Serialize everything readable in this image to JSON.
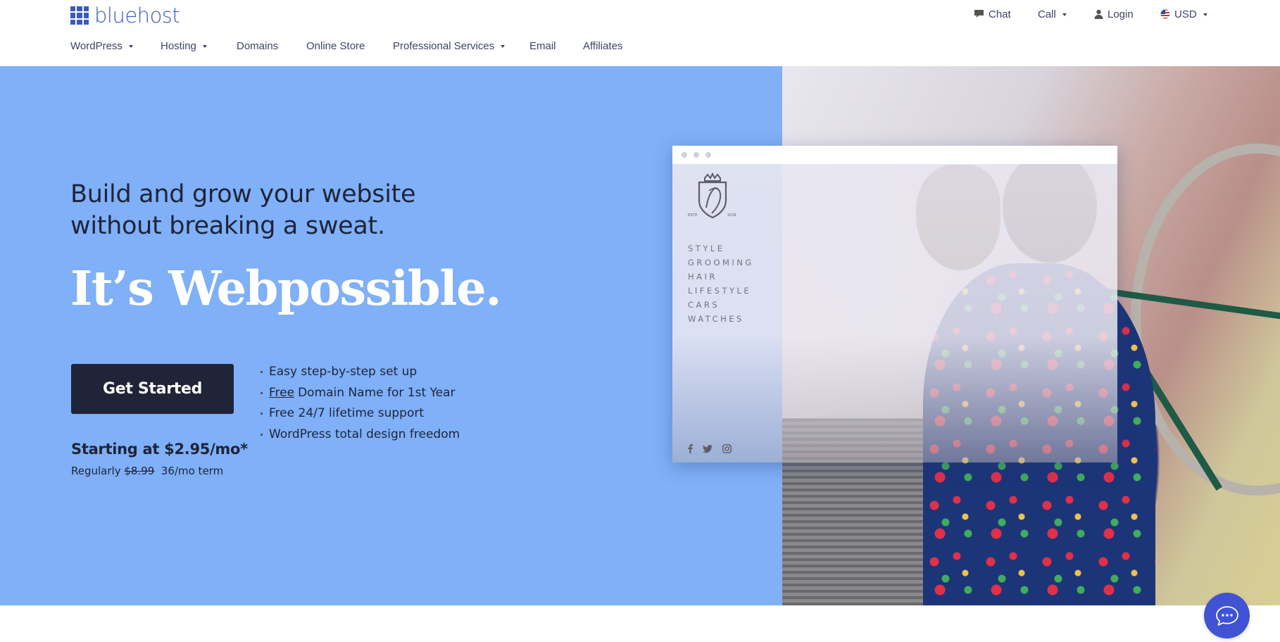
{
  "brand": {
    "name": "bluehost",
    "logo_icon": "grid-logo-icon",
    "color": "#3b5bb8"
  },
  "nav": {
    "items": [
      {
        "label": "WordPress",
        "has_dropdown": true
      },
      {
        "label": "Hosting",
        "has_dropdown": true
      },
      {
        "label": "Domains",
        "has_dropdown": false
      },
      {
        "label": "Online Store",
        "has_dropdown": false
      },
      {
        "label": "Professional Services",
        "has_dropdown": true
      },
      {
        "label": "Email",
        "has_dropdown": false
      },
      {
        "label": "Affiliates",
        "has_dropdown": false
      }
    ]
  },
  "utility": {
    "chat": {
      "label": "Chat",
      "icon": "chat-icon"
    },
    "call": {
      "label": "Call",
      "icon": "chevron-down-icon"
    },
    "login": {
      "label": "Login",
      "icon": "user-icon"
    },
    "currency": {
      "label": "USD",
      "icon": "us-flag-icon"
    }
  },
  "hero": {
    "subtitle_line1": "Build and grow your website",
    "subtitle_line2": "without breaking a sweat.",
    "title": "It’s Webpossible.",
    "cta_label": "Get Started",
    "price_text": "Starting at $2.95/mo*",
    "regular_label": "Regularly",
    "regular_price": "$8.99",
    "term": "36/mo term",
    "features": [
      {
        "underlined": "",
        "text": "Easy step-by-step set up"
      },
      {
        "underlined": "Free",
        "text": "Domain Name for 1st Year"
      },
      {
        "underlined": "",
        "text": "Free 24/7 lifetime support"
      },
      {
        "underlined": "",
        "text": "WordPress total design freedom"
      }
    ],
    "background_color": "#7fb0f8",
    "button_color": "#1f2438"
  },
  "mockup": {
    "logo_left_text": "ESTD",
    "logo_right_text": "2018",
    "menu": [
      "STYLE",
      "GROOMING",
      "HAIR",
      "LIFESTYLE",
      "CARS",
      "WATCHES"
    ],
    "social": [
      "facebook-icon",
      "twitter-icon",
      "instagram-icon"
    ]
  },
  "chat_widget": {
    "icon": "chat-bubble-icon",
    "color": "#4053d3"
  }
}
